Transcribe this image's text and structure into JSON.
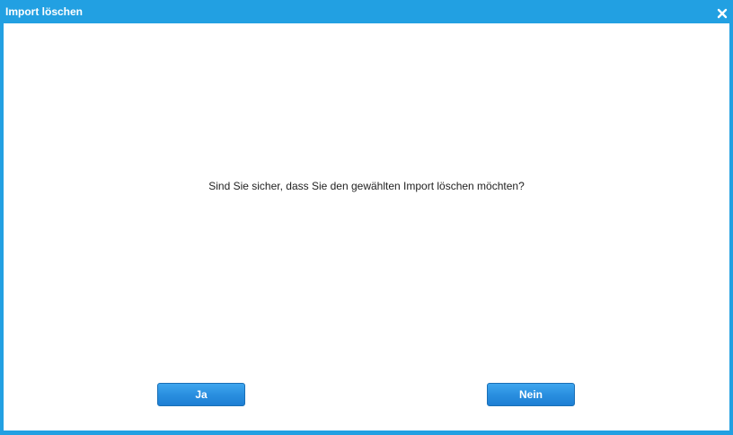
{
  "dialog": {
    "title": "Import löschen",
    "close_icon": "close-icon",
    "message": "Sind Sie sicher, dass Sie den gewählten Import löschen möchten?",
    "buttons": {
      "yes_label": "Ja",
      "no_label": "Nein"
    }
  },
  "colors": {
    "accent": "#22a0e2",
    "button": "#2a8fe0"
  }
}
